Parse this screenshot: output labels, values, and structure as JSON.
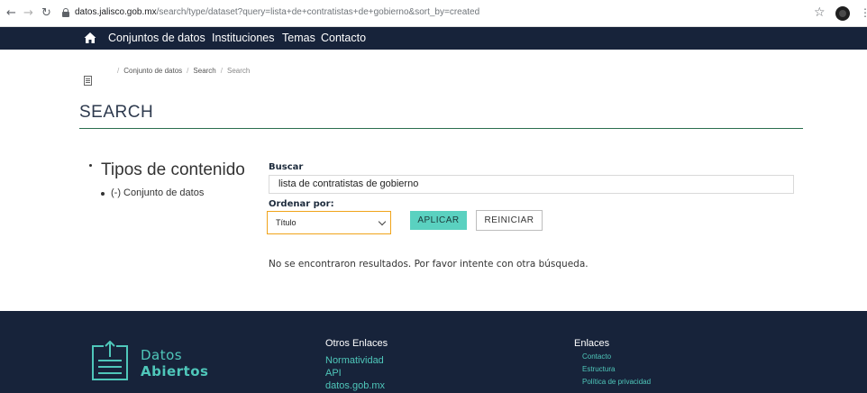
{
  "browser": {
    "url_domain": "datos.jalisco.gob.mx",
    "url_path": "/search/type/dataset?query=lista+de+contratistas+de+gobierno&sort_by=created"
  },
  "topnav": {
    "items": [
      "Conjuntos de datos",
      "Instituciones",
      "Temas",
      "Contacto"
    ]
  },
  "breadcrumb": [
    "Conjunto de datos",
    "Search",
    "Search"
  ],
  "page": {
    "title": "SEARCH"
  },
  "facets": {
    "title": "Tipos de contenido",
    "items": [
      "(-) Conjunto de datos"
    ]
  },
  "form": {
    "search_label": "Buscar",
    "search_value": "lista de contratistas de gobierno",
    "sort_label": "Ordenar por:",
    "sort_value": "Título",
    "apply_label": "APLICAR",
    "reset_label": "REINICIAR"
  },
  "results": {
    "message": "No se encontraron resultados. Por favor intente con otra búsqueda."
  },
  "footer": {
    "logo_line1": "Datos",
    "logo_line2": "Abiertos",
    "col1_heading": "Otros Enlaces",
    "col1_links": [
      "Normatividad",
      "API",
      "datos.gob.mx"
    ],
    "col2_heading": "Enlaces",
    "col2_links": [
      "Contacto",
      "Estructura",
      "Política de privacidad"
    ]
  },
  "colors": {
    "nav_bg": "#17233a",
    "accent_teal": "#5ad1c0",
    "select_border": "#f0a41a"
  }
}
